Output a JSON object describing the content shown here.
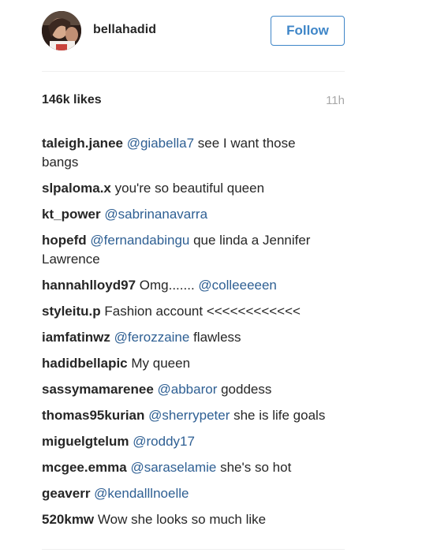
{
  "post": {
    "username": "bellahadid",
    "follow_label": "Follow",
    "likes": "146k likes",
    "timestamp": "11h"
  },
  "colors": {
    "accent": "#3f86c8",
    "mention": "#2e5f93",
    "muted": "#a8a8a8"
  },
  "comments": [
    {
      "user": "taleigh.janee",
      "mention": "@giabella7",
      "text": " see I want those bangs"
    },
    {
      "user": "slpaloma.x",
      "mention": "",
      "text": "you're so beautiful queen"
    },
    {
      "user": "kt_power",
      "mention": "@sabrinanavarra",
      "text": ""
    },
    {
      "user": "hopefd",
      "mention": "@fernandabingu",
      "text": " que linda a Jennifer Lawrence"
    },
    {
      "user": "hannahlloyd97",
      "mention": "@colleeeeen",
      "text": "Omg....... "
    },
    {
      "user": "styleitu.p",
      "mention": "",
      "text": "Fashion account <<<<<<<<<<<<"
    },
    {
      "user": "iamfatinwz",
      "mention": "@ferozzaine",
      "text": " flawless"
    },
    {
      "user": "hadidbellapic",
      "mention": "",
      "text": "My queen"
    },
    {
      "user": "sassymamarenee",
      "mention": "@abbaror",
      "text": " goddess"
    },
    {
      "user": "thomas95kurian",
      "mention": "@sherrypeter",
      "text": " she is life goals"
    },
    {
      "user": "miguelgtelum",
      "mention": "@roddy17",
      "text": ""
    },
    {
      "user": "mcgee.emma",
      "mention": "@saraselamie",
      "text": " she's so hot"
    },
    {
      "user": "geaverr",
      "mention": "@kendalllnoelle",
      "text": ""
    },
    {
      "user": "520kmw",
      "mention": "",
      "text": "Wow she looks so much like"
    }
  ]
}
